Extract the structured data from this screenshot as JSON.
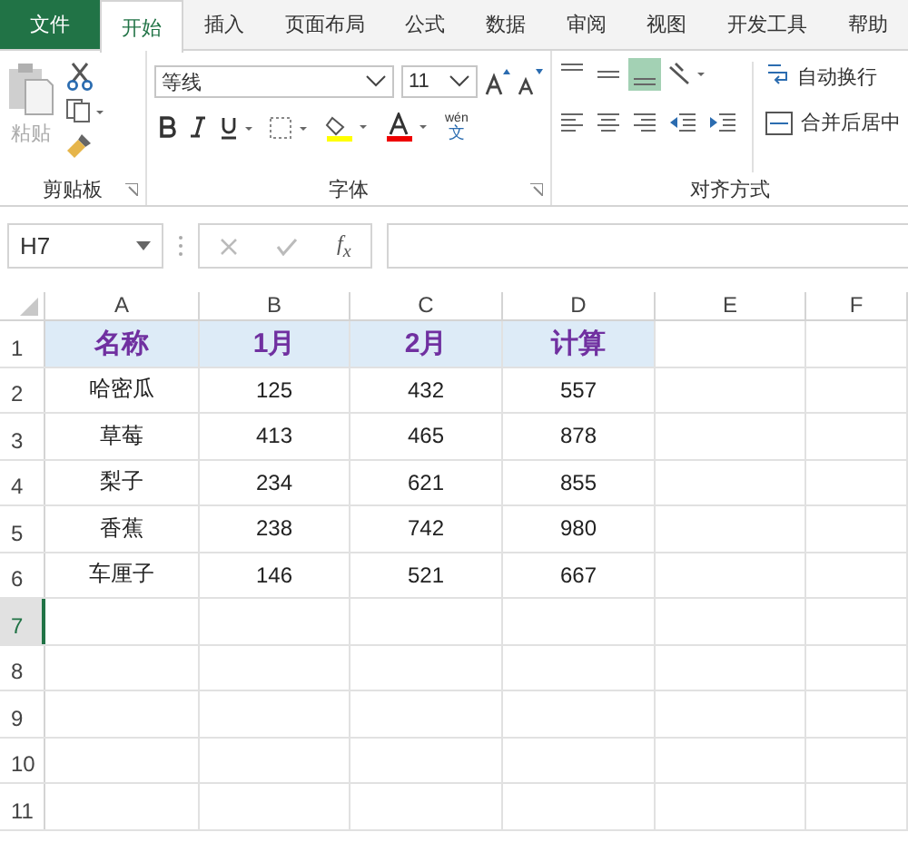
{
  "tabs": [
    {
      "label": "文件",
      "kind": "file",
      "selected": false
    },
    {
      "label": "开始",
      "kind": "tab",
      "selected": true
    },
    {
      "label": "插入",
      "kind": "tab",
      "selected": false
    },
    {
      "label": "页面布局",
      "kind": "tab",
      "selected": false
    },
    {
      "label": "公式",
      "kind": "tab",
      "selected": false
    },
    {
      "label": "数据",
      "kind": "tab",
      "selected": false
    },
    {
      "label": "审阅",
      "kind": "tab",
      "selected": false
    },
    {
      "label": "视图",
      "kind": "tab",
      "selected": false
    },
    {
      "label": "开发工具",
      "kind": "tab",
      "selected": false
    },
    {
      "label": "帮助",
      "kind": "tab",
      "selected": false
    }
  ],
  "ribbon": {
    "clipboard": {
      "paste": "粘贴",
      "label": "剪贴板"
    },
    "font": {
      "name": "等线",
      "size": "11",
      "phonetic_top": "wén",
      "phonetic_bottom": "文",
      "label": "字体"
    },
    "alignment": {
      "vertical": [
        {
          "kind": "top",
          "selected": false
        },
        {
          "kind": "middle",
          "selected": false
        },
        {
          "kind": "bottom",
          "selected": true
        }
      ],
      "wrap": "自动换行",
      "merge": "合并后居中",
      "label": "对齐方式"
    }
  },
  "formula_bar": {
    "name_box": "H7",
    "fx": "f$_{x}$"
  },
  "sheet": {
    "columns": [
      "A",
      "B",
      "C",
      "D",
      "E",
      "F"
    ],
    "rows": [
      {
        "header": "1",
        "kind": "title",
        "selected": false,
        "cells": [
          "名称",
          "1月",
          "2月",
          "计算"
        ]
      },
      {
        "header": "2",
        "kind": "data",
        "selected": false,
        "cells": [
          "哈密瓜",
          "125",
          "432",
          "557"
        ]
      },
      {
        "header": "3",
        "kind": "data",
        "selected": false,
        "cells": [
          "草莓",
          "413",
          "465",
          "878"
        ]
      },
      {
        "header": "4",
        "kind": "data",
        "selected": false,
        "cells": [
          "梨子",
          "234",
          "621",
          "855"
        ]
      },
      {
        "header": "5",
        "kind": "data",
        "selected": false,
        "cells": [
          "香蕉",
          "238",
          "742",
          "980"
        ]
      },
      {
        "header": "6",
        "kind": "data",
        "selected": false,
        "cells": [
          "车厘子",
          "146",
          "521",
          "667"
        ]
      },
      {
        "header": "7",
        "kind": "data",
        "selected": true
      },
      {
        "header": "8",
        "kind": "data",
        "selected": false
      },
      {
        "header": "9",
        "kind": "data",
        "selected": false
      },
      {
        "header": "10",
        "kind": "data",
        "selected": false
      },
      {
        "header": "11",
        "kind": "data",
        "selected": false
      }
    ]
  }
}
